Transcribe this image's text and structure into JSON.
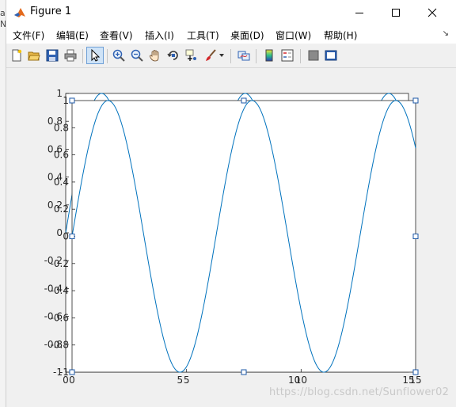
{
  "window": {
    "title": "Figure 1",
    "controls": {
      "minimize": "minimize-icon",
      "maximize": "maximize-icon",
      "close": "close-icon"
    }
  },
  "menubar": {
    "items": [
      {
        "label": "文件(F)"
      },
      {
        "label": "编辑(E)"
      },
      {
        "label": "查看(V)"
      },
      {
        "label": "插入(I)"
      },
      {
        "label": "工具(T)"
      },
      {
        "label": "桌面(D)"
      },
      {
        "label": "窗口(W)"
      },
      {
        "label": "帮助(H)"
      }
    ],
    "expand_icon": "menu-dock-arrow-icon"
  },
  "toolbar": {
    "buttons": [
      {
        "icon": "new-figure-icon"
      },
      {
        "icon": "open-file-icon"
      },
      {
        "icon": "save-icon"
      },
      {
        "icon": "print-icon"
      },
      {
        "icon": "edit-plot-cursor-icon",
        "selected": true
      },
      {
        "icon": "zoom-in-icon"
      },
      {
        "icon": "zoom-out-icon"
      },
      {
        "icon": "pan-hand-icon"
      },
      {
        "icon": "rotate-3d-icon"
      },
      {
        "icon": "data-cursor-icon"
      },
      {
        "icon": "brush-icon"
      },
      {
        "icon": "link-plot-icon"
      },
      {
        "icon": "insert-colorbar-icon"
      },
      {
        "icon": "insert-legend-icon"
      },
      {
        "icon": "hide-plot-tools-icon"
      },
      {
        "icon": "show-plot-tools-icon"
      }
    ]
  },
  "chart_data": [
    {
      "type": "line",
      "title": "",
      "xlabel": "",
      "ylabel": "",
      "xlim": [
        0,
        15
      ],
      "ylim": [
        -1,
        1
      ],
      "xticks": [
        "0",
        "5",
        "10",
        "15"
      ],
      "yticks": [
        "-1",
        "-0.8",
        "-0.6",
        "-0.4",
        "-0.2",
        "0",
        "0.2",
        "0.4",
        "0.6",
        "0.8",
        "1"
      ],
      "grid": false,
      "note_series": "y = sin(x)",
      "series": [
        {
          "function": "sin",
          "x_range": [
            0,
            15
          ],
          "color": "#0072bd"
        }
      ],
      "role": "background axes"
    },
    {
      "type": "line",
      "title": "",
      "xlabel": "",
      "ylabel": "",
      "xlim": [
        0,
        15
      ],
      "ylim": [
        -1,
        1
      ],
      "xticks": [
        "0",
        "5",
        "10",
        "15"
      ],
      "yticks": [
        "-1",
        "-0.8",
        "-0.6",
        "-0.4",
        "-0.2",
        "0",
        "0.2",
        "0.4",
        "0.6",
        "0.8",
        "1"
      ],
      "grid": false,
      "series": [
        {
          "function": "sin",
          "x_range": [
            0,
            15
          ],
          "color": "#0072bd"
        }
      ],
      "role": "selected foreground axes",
      "selected": true
    }
  ],
  "watermark": "https://blog.csdn.net/Sunflower02"
}
